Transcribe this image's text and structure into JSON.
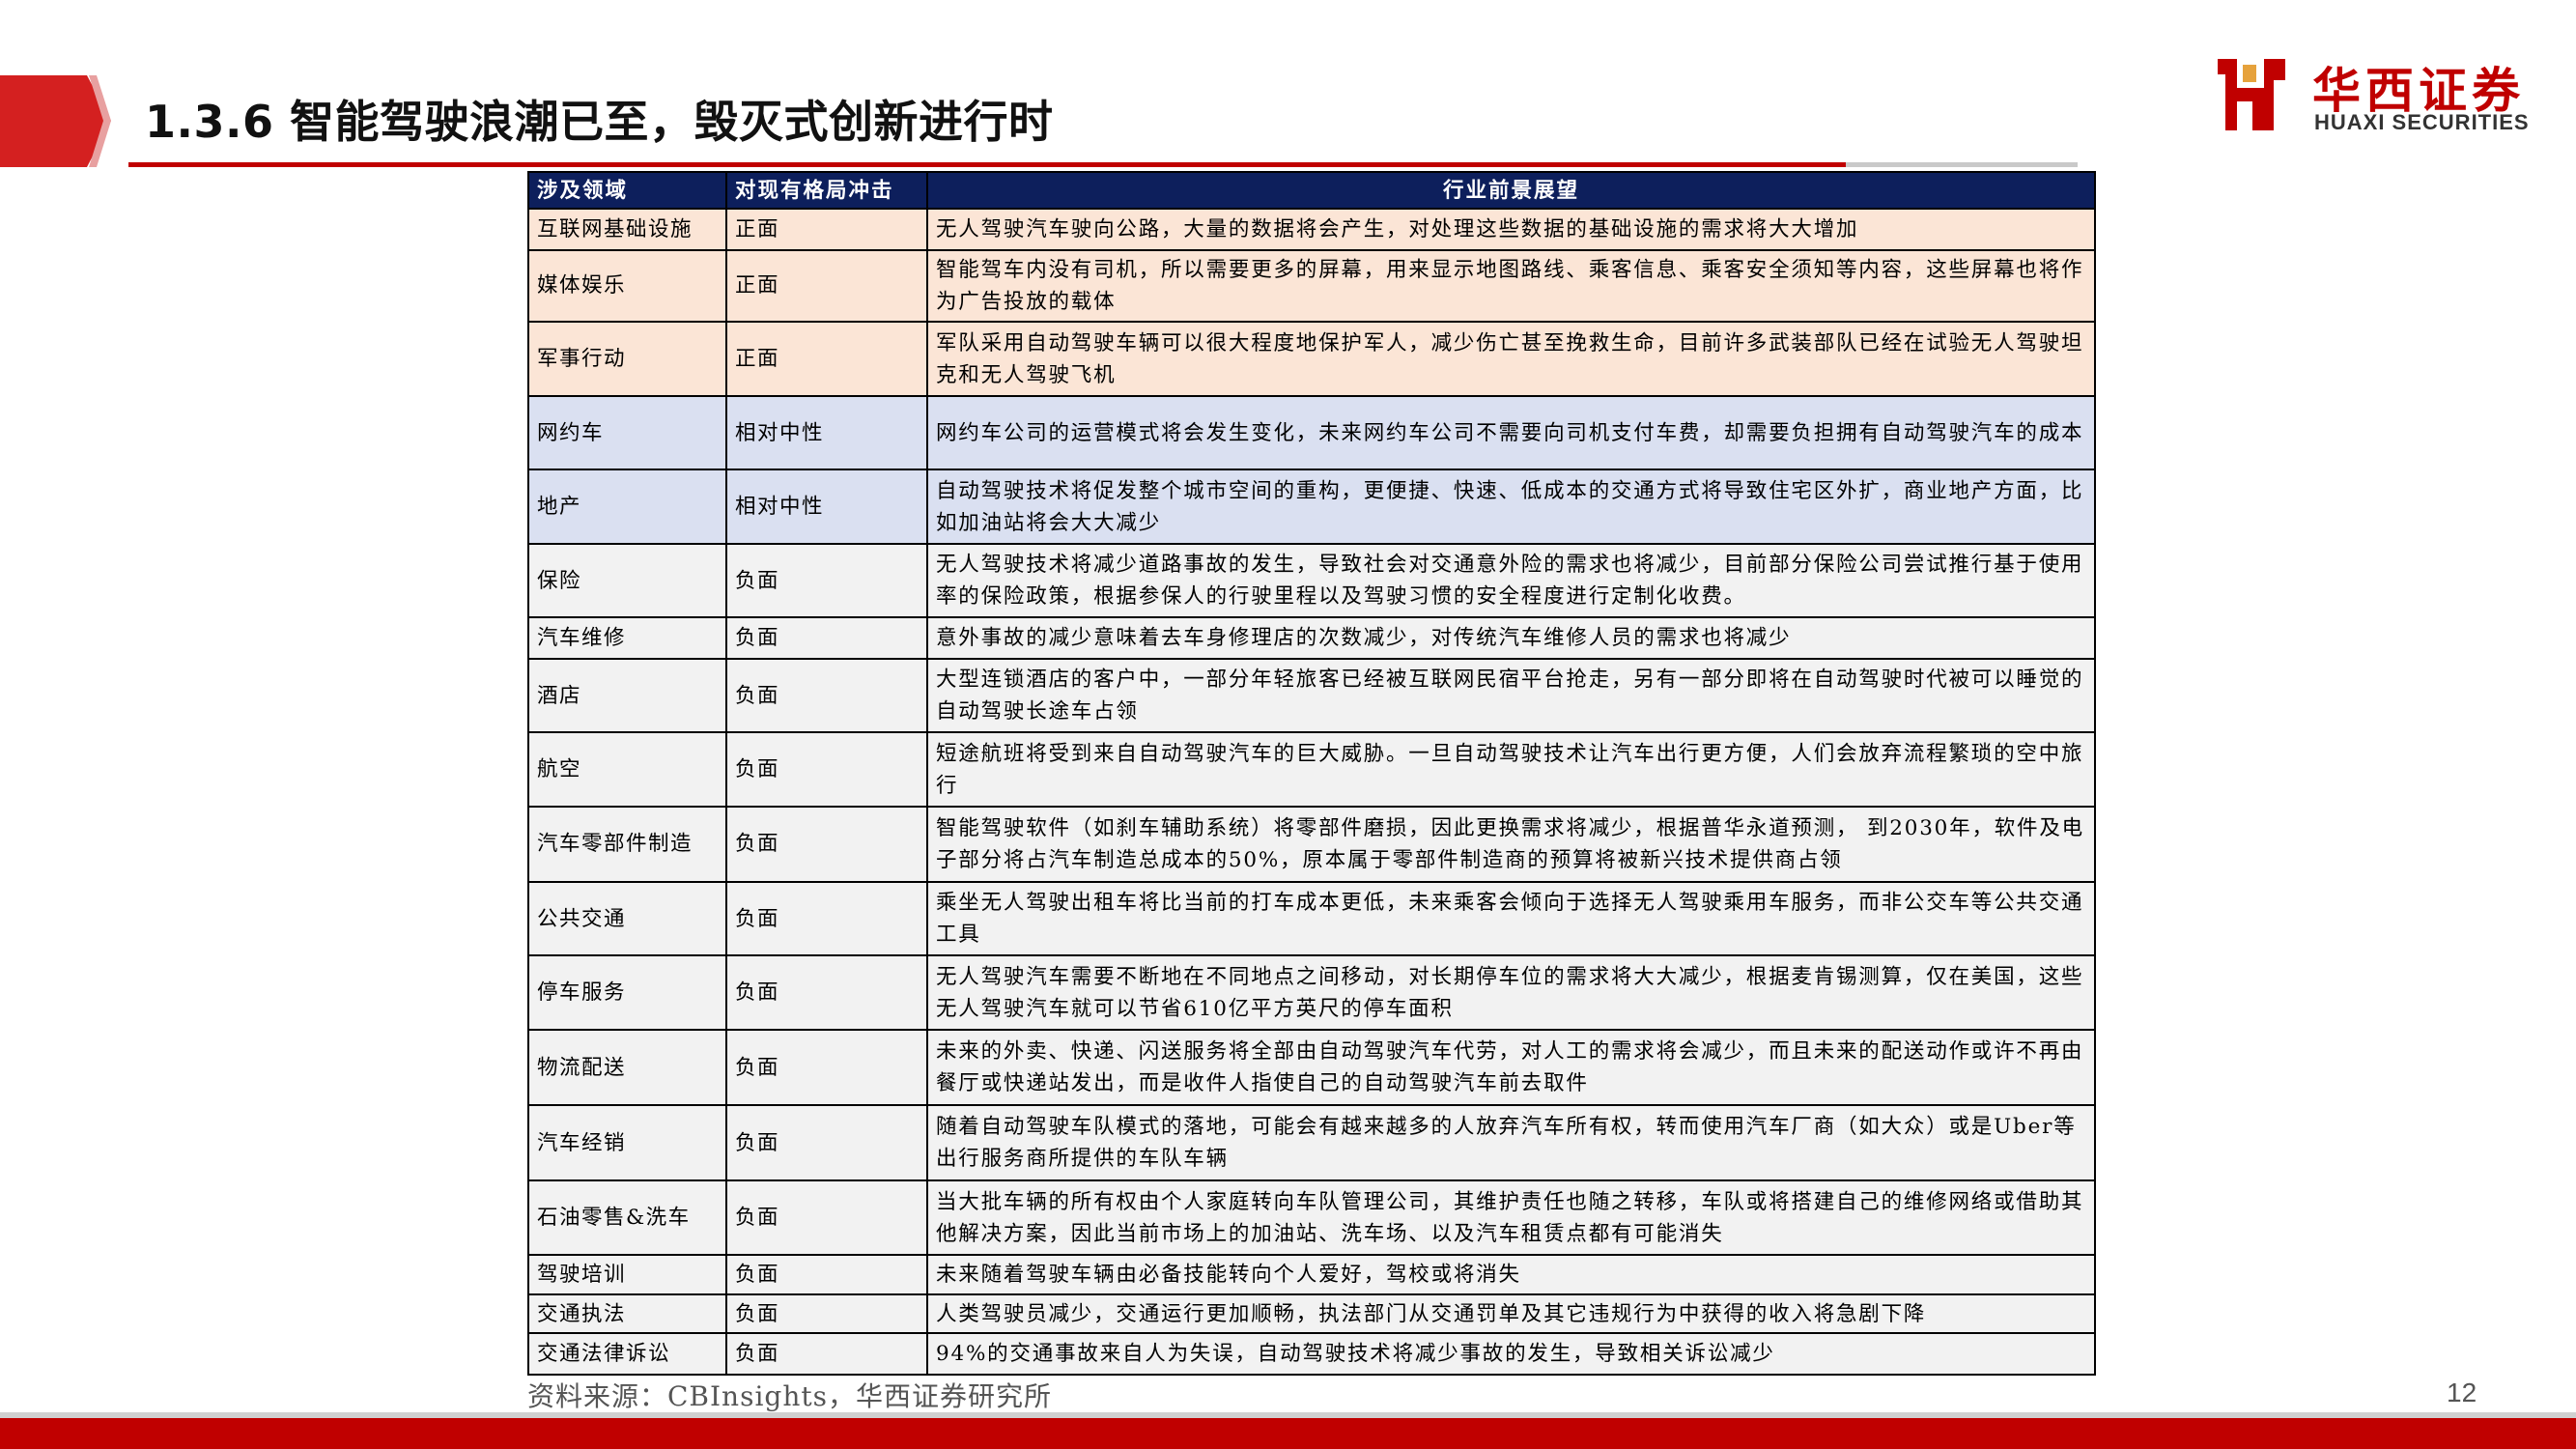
{
  "header": {
    "title": "1.3.6 智能驾驶浪潮已至，毁灭式创新进行时",
    "accent_color": "#c00000"
  },
  "logo": {
    "name_cn": "华西证券",
    "name_en": "HUAXI SECURITIES",
    "color": "#c00000"
  },
  "table": {
    "header_color": "#0d1f5c",
    "columns": [
      "涉及领域",
      "对现有格局冲击",
      "行业前景展望"
    ],
    "impact_colors": {
      "正面": "#fbe5d6",
      "相对中性": "#dae0f1",
      "负面": "#f2f2f2"
    },
    "rows": [
      {
        "field": "互联网基础设施",
        "impact": "正面",
        "outlook": "无人驾驶汽车驶向公路，大量的数据将会产生，对处理这些数据的基础设施的需求将大大增加"
      },
      {
        "field": "媒体娱乐",
        "impact": "正面",
        "outlook": "智能驾车内没有司机，所以需要更多的屏幕，用来显示地图路线、乘客信息、乘客安全须知等内容，这些屏幕也将作为广告投放的载体"
      },
      {
        "field": "军事行动",
        "impact": "正面",
        "outlook": "军队采用自动驾驶车辆可以很大程度地保护军人，减少伤亡甚至挽救生命，目前许多武装部队已经在试验无人驾驶坦克和无人驾驶飞机"
      },
      {
        "field": "网约车",
        "impact": "相对中性",
        "outlook": "网约车公司的运营模式将会发生变化，未来网约车公司不需要向司机支付车费，却需要负担拥有自动驾驶汽车的成本"
      },
      {
        "field": "地产",
        "impact": "相对中性",
        "outlook": "自动驾驶技术将促发整个城市空间的重构，更便捷、快速、低成本的交通方式将导致住宅区外扩，商业地产方面，比如加油站将会大大减少"
      },
      {
        "field": "保险",
        "impact": "负面",
        "outlook": "无人驾驶技术将减少道路事故的发生，导致社会对交通意外险的需求也将减少，目前部分保险公司尝试推行基于使用率的保险政策，根据参保人的行驶里程以及驾驶习惯的安全程度进行定制化收费。"
      },
      {
        "field": "汽车维修",
        "impact": "负面",
        "outlook": "意外事故的减少意味着去车身修理店的次数减少，对传统汽车维修人员的需求也将减少"
      },
      {
        "field": "酒店",
        "impact": "负面",
        "outlook": "大型连锁酒店的客户中，一部分年轻旅客已经被互联网民宿平台抢走，另有一部分即将在自动驾驶时代被可以睡觉的自动驾驶长途车占领"
      },
      {
        "field": "航空",
        "impact": "负面",
        "outlook": "短途航班将受到来自自动驾驶汽车的巨大威胁。一旦自动驾驶技术让汽车出行更方便，人们会放弃流程繁琐的空中旅行"
      },
      {
        "field": "汽车零部件制造",
        "impact": "负面",
        "outlook": "智能驾驶软件（如刹车辅助系统）将零部件磨损，因此更换需求将减少，根据普华永道预测， 到2030年，软件及电子部分将占汽车制造总成本的50%，原本属于零部件制造商的预算将被新兴技术提供商占领"
      },
      {
        "field": "公共交通",
        "impact": "负面",
        "outlook": "乘坐无人驾驶出租车将比当前的打车成本更低，未来乘客会倾向于选择无人驾驶乘用车服务，而非公交车等公共交通工具"
      },
      {
        "field": "停车服务",
        "impact": "负面",
        "outlook": "无人驾驶汽车需要不断地在不同地点之间移动，对长期停车位的需求将大大减少，根据麦肯锡测算，仅在美国，这些无人驾驶汽车就可以节省610亿平方英尺的停车面积"
      },
      {
        "field": "物流配送",
        "impact": "负面",
        "outlook": "未来的外卖、快递、闪送服务将全部由自动驾驶汽车代劳，对人工的需求将会减少，而且未来的配送动作或许不再由餐厅或快递站发出，而是收件人指使自己的自动驾驶汽车前去取件"
      },
      {
        "field": "汽车经销",
        "impact": "负面",
        "outlook": "随着自动驾驶车队模式的落地，可能会有越来越多的人放弃汽车所有权，转而使用汽车厂商（如大众）或是Uber等出行服务商所提供的车队车辆"
      },
      {
        "field": "石油零售&洗车",
        "impact": "负面",
        "outlook": "当大批车辆的所有权由个人家庭转向车队管理公司，其维护责任也随之转移，车队或将搭建自己的维修网络或借助其他解决方案，因此当前市场上的加油站、洗车场、以及汽车租赁点都有可能消失"
      },
      {
        "field": "驾驶培训",
        "impact": "负面",
        "outlook": "未来随着驾驶车辆由必备技能转向个人爱好，驾校或将消失"
      },
      {
        "field": "交通执法",
        "impact": "负面",
        "outlook": "人类驾驶员减少，交通运行更加顺畅，执法部门从交通罚单及其它违规行为中获得的收入将急剧下降"
      },
      {
        "field": "交通法律诉讼",
        "impact": "负面",
        "outlook": "94%的交通事故来自人为失误，自动驾驶技术将减少事故的发生，导致相关诉讼减少"
      }
    ]
  },
  "footer": {
    "source": "资料来源：CBInsights，华西证券研究所",
    "page_number": "12"
  }
}
